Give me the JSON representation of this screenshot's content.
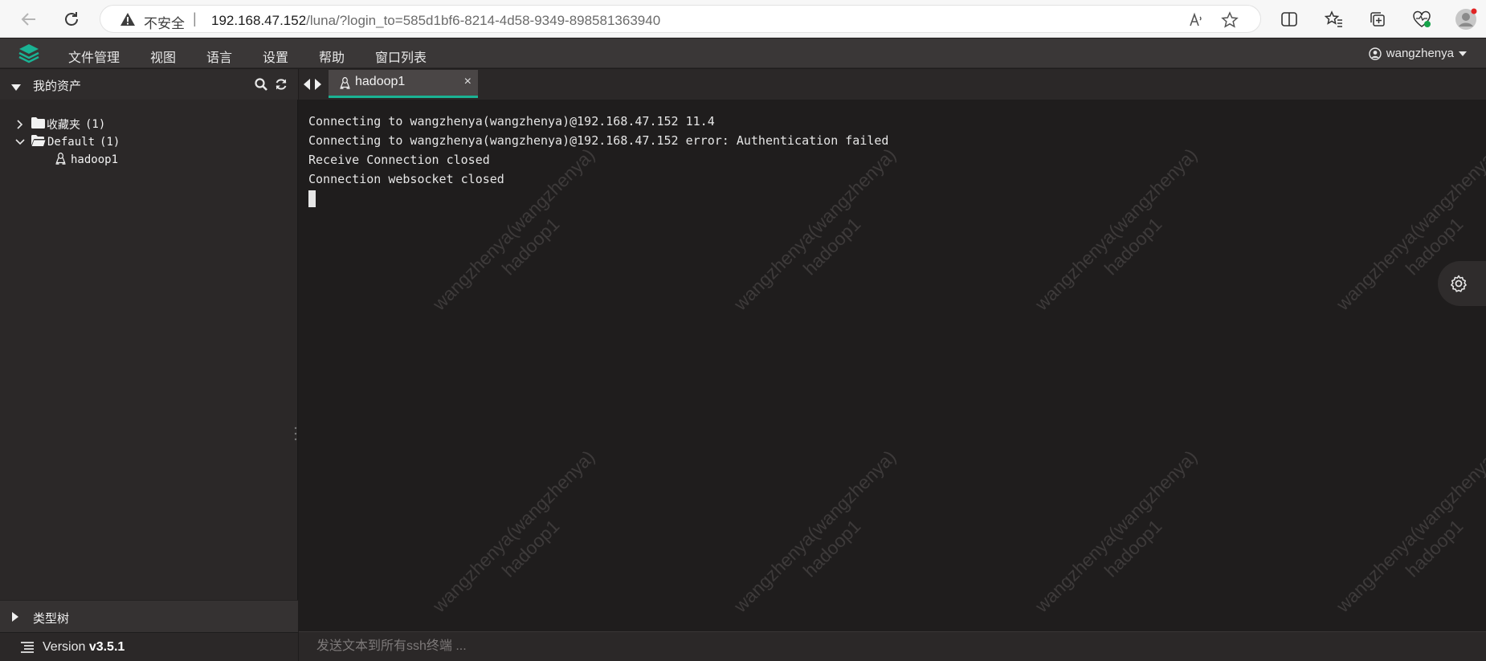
{
  "browser": {
    "insecure_label": "不安全",
    "separator": "|",
    "url_host": "192.168.47.152",
    "url_path": "/luna/?login_to=585d1bf6-8214-4d58-9349-898581363940"
  },
  "header": {
    "menu": [
      "文件管理",
      "视图",
      "语言",
      "设置",
      "帮助",
      "窗口列表"
    ],
    "username": "wangzhenya"
  },
  "sidebar": {
    "title": "我的资产",
    "tree": [
      {
        "name": "收藏夹",
        "count": "(1)"
      },
      {
        "name": "Default",
        "count": "(1)"
      },
      {
        "name": "hadoop1"
      }
    ],
    "bottom_title": "类型树",
    "version_prefix": "Version ",
    "version": "v3.5.1"
  },
  "tab": {
    "label": "hadoop1",
    "close_symbol": "×"
  },
  "terminal": {
    "lines": [
      "Connecting to wangzhenya(wangzhenya)@192.168.47.152 11.4",
      "Connecting to wangzhenya(wangzhenya)@192.168.47.152 error: Authentication failed",
      "Receive Connection closed",
      "Connection websocket closed"
    ],
    "watermark_user": "wangzhenya(wangzhenya)",
    "watermark_host": "hadoop1"
  },
  "sendbar": {
    "placeholder": "发送文本到所有ssh终端 ..."
  },
  "colors": {
    "accent": "#1ab394",
    "background": "#1f1d1d",
    "sidebar": "#2b2828"
  }
}
